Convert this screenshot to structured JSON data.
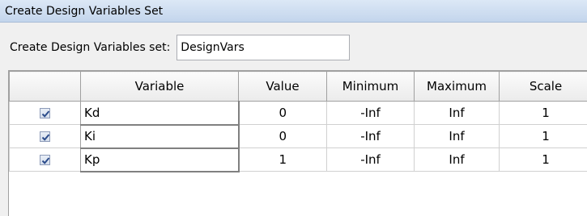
{
  "window": {
    "title": "Create Design Variables Set"
  },
  "form": {
    "label": "Create Design Variables set:",
    "name_value": "DesignVars"
  },
  "table": {
    "columns": [
      "",
      "Variable",
      "Value",
      "Minimum",
      "Maximum",
      "Scale"
    ],
    "rows": [
      {
        "checked": true,
        "variable": "Kd",
        "value": "0",
        "minimum": "-Inf",
        "maximum": "Inf",
        "scale": "1"
      },
      {
        "checked": true,
        "variable": "Ki",
        "value": "0",
        "minimum": "-Inf",
        "maximum": "Inf",
        "scale": "1"
      },
      {
        "checked": true,
        "variable": "Kp",
        "value": "1",
        "minimum": "-Inf",
        "maximum": "Inf",
        "scale": "1"
      }
    ]
  },
  "colors": {
    "titlebar": "#c3d5ec",
    "checkmark": "#2b4b8a"
  },
  "icons": {
    "checkbox": "checkbox-checked-icon"
  }
}
